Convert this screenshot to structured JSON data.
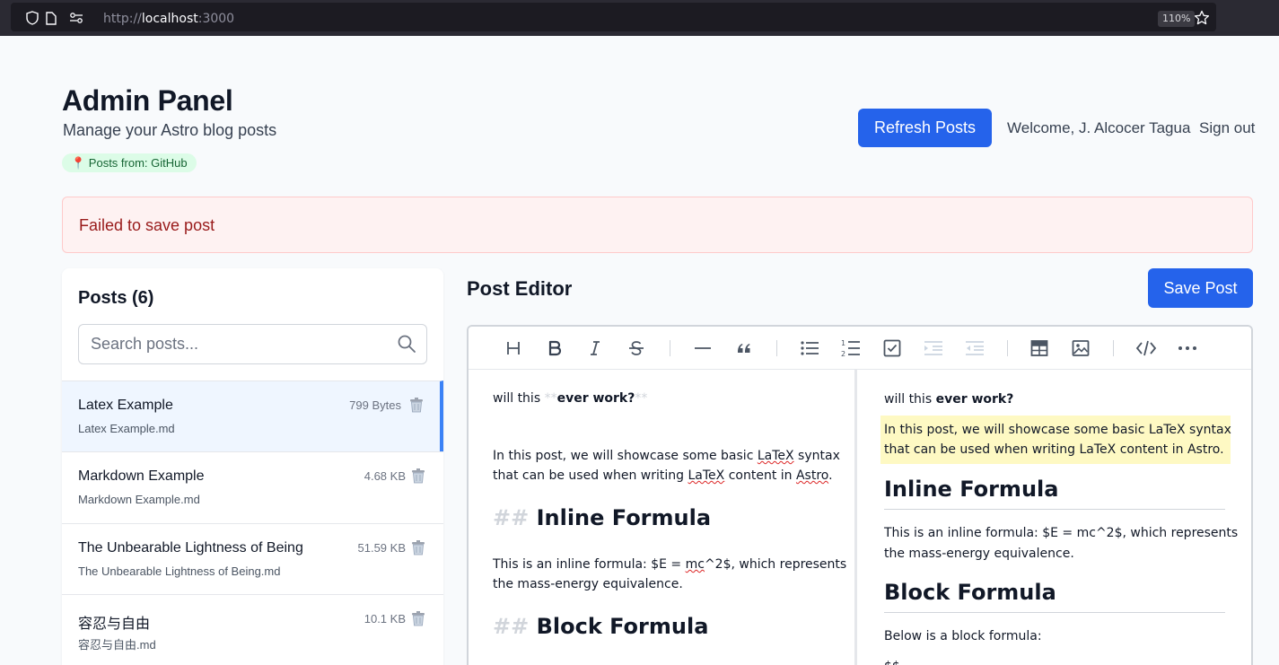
{
  "browser": {
    "url_prefix": "http://",
    "url_host": "localhost",
    "url_port": ":3000",
    "zoom": "110%"
  },
  "header": {
    "title": "Admin Panel",
    "subtitle": "Manage your Astro blog posts",
    "source_badge": "📍 Posts from: GitHub",
    "refresh_label": "Refresh Posts",
    "welcome": "Welcome, J. Alcocer Tagua",
    "signout": "Sign out"
  },
  "error": {
    "message": "Failed to save post"
  },
  "sidebar": {
    "title": "Posts (6)",
    "search_placeholder": "Search posts...",
    "posts": [
      {
        "title": "Latex Example",
        "file": "Latex Example.md",
        "size": "799 Bytes",
        "active": true
      },
      {
        "title": "Markdown Example",
        "file": "Markdown Example.md",
        "size": "4.68 KB",
        "active": false
      },
      {
        "title": "The Unbearable Lightness of Being",
        "file": "The Unbearable Lightness of Being.md",
        "size": "51.59 KB",
        "active": false
      },
      {
        "title": "容忍与自由",
        "file": "容忍与自由.md",
        "size": "10.1 KB",
        "active": false
      }
    ]
  },
  "editor": {
    "title": "Post Editor",
    "save_label": "Save Post",
    "toolbar": [
      "heading-icon",
      "bold-icon",
      "italic-icon",
      "strikethrough-icon",
      "horizontal-rule-icon",
      "quote-icon",
      "bullet-list-icon",
      "ordered-list-icon",
      "task-list-icon",
      "indent-icon",
      "outdent-icon",
      "table-icon",
      "image-icon",
      "code-icon",
      "more-icon"
    ],
    "markdown": {
      "line1_plain": "will this ",
      "line1_marker_open": "**",
      "line1_bold": "ever work?",
      "line1_marker_close": "**",
      "para1_a": "In this post, we will showcase some basic ",
      "para1_latex1": "LaTeX",
      "para1_b": " syntax",
      "para1_c": "that can be used when writing ",
      "para1_latex2": "LaTeX",
      "para1_d": " content in ",
      "para1_astro": "Astro",
      "para1_e": ".",
      "h2_marker": "##",
      "h2_inline": "Inline Formula",
      "para2_a": "This is an inline formula: $E = ",
      "para2_mc": "mc",
      "para2_b": "^2$, which represents",
      "para2_c": "the mass-energy equivalence.",
      "h2_block": "Block Formula"
    },
    "preview": {
      "line1_plain": "will this ",
      "line1_bold": "ever work?",
      "para1_l1": "In this post, we will showcase some basic LaTeX syntax",
      "para1_l2": "that can be used when writing LaTeX content in Astro.",
      "h2_inline": "Inline Formula",
      "para2_l1": "This is an inline formula: $E = mc^2$, which represents",
      "para2_l2": "the mass-energy equivalence.",
      "h2_block": "Block Formula",
      "para3": "Below is a block formula:",
      "para4": "$$"
    }
  },
  "colors": {
    "primary": "#2563eb",
    "error_bg": "#fef2f2",
    "error_text": "#991b1b",
    "badge_bg": "#dcfce7",
    "badge_text": "#166534",
    "active_item_bg": "#eff6ff",
    "active_item_border": "#3b82f6",
    "highlight": "#fef9c3"
  }
}
